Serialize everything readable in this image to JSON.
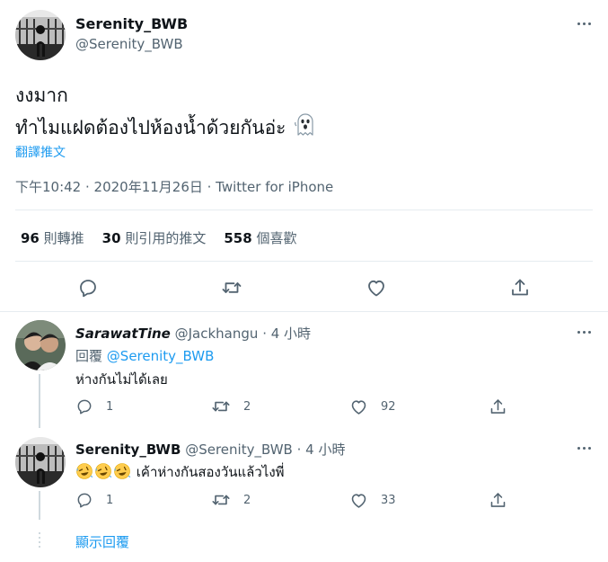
{
  "main_tweet": {
    "display_name": "Serenity_BWB",
    "handle": "@Serenity_BWB",
    "text_line1": "งงมาก",
    "text_line2": "ทำไมแฝดต้องไปห้องน้ำด้วยกันอ่ะ",
    "text_emoji": "ghost-emoji",
    "translate_label": "翻譯推文",
    "timestamp": "下午10:42 · 2020年11月26日 · Twitter for iPhone",
    "stats": {
      "retweets_count": "96",
      "retweets_label": "則轉推",
      "quotes_count": "30",
      "quotes_label": "則引用的推文",
      "likes_count": "558",
      "likes_label": "個喜歡"
    },
    "actions": [
      "reply-icon",
      "retweet-icon",
      "like-icon",
      "share-icon"
    ]
  },
  "replies": [
    {
      "display_name": "SarawatTine",
      "handle": "@Jackhangu",
      "time": "· 4 小時",
      "replying_label": "回覆",
      "replying_to": "@Serenity_BWB",
      "text": "ห่างกันไม่ได้เลย",
      "reply_count": "1",
      "retweet_count": "2",
      "like_count": "92"
    },
    {
      "display_name": "Serenity_BWB",
      "handle": "@Serenity_BWB",
      "time": "· 4 小時",
      "emojis": "rolling-on-floor-laughing-emoji x3",
      "text": "เค้าห่างกันสองวันแล้วไงพี่",
      "reply_count": "1",
      "retweet_count": "2",
      "like_count": "33"
    }
  ],
  "show_replies_label": "顯示回覆",
  "colors": {
    "accent": "#1d9bf0",
    "text_primary": "#0f1419",
    "text_secondary": "#536471",
    "divider": "#e6ecf0"
  }
}
